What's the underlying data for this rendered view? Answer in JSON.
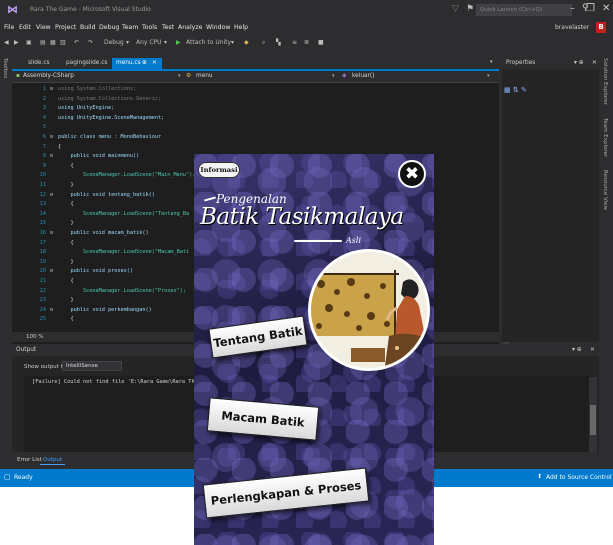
{
  "window": {
    "title": "Rara The Game - Microsoft Visual Studio"
  },
  "titlebar": {
    "quick_launch_placeholder": "Quick Launch (Ctrl+Q)"
  },
  "menu": [
    "File",
    "Edit",
    "View",
    "Project",
    "Build",
    "Debug",
    "Team",
    "Tools",
    "Test",
    "Analyze",
    "Window",
    "Help"
  ],
  "user": {
    "name": "bravelaster",
    "badge": "B"
  },
  "toolbar": {
    "config": "Debug",
    "platform": "Any CPU",
    "attach": "Attach to Unity"
  },
  "left_rail": "Toolbox",
  "tabs": [
    {
      "label": "slide.cs"
    },
    {
      "label": "pagingslide.cs"
    },
    {
      "label": "menu.cs",
      "active": true
    }
  ],
  "navbar": {
    "project": "Assembly-CSharp",
    "class": "menu",
    "member": "keluar()"
  },
  "code": {
    "lines": [
      {
        "n": "1",
        "fold": "⊟",
        "text": "using System.Collections;",
        "dim": true
      },
      {
        "n": "2",
        "fold": "",
        "text": "using System.Collections.Generic;",
        "dim": true
      },
      {
        "n": "3",
        "fold": "",
        "text": "using UnityEngine;"
      },
      {
        "n": "4",
        "fold": "",
        "text": "using UnityEngine.SceneManagement;"
      },
      {
        "n": "5",
        "fold": "",
        "text": ""
      },
      {
        "n": "6",
        "fold": "⊟",
        "text": "public class menu : MonoBehaviour"
      },
      {
        "n": "7",
        "fold": "",
        "text": "{"
      },
      {
        "n": "8",
        "fold": "⊟",
        "text": "    public void mainmenu()"
      },
      {
        "n": "9",
        "fold": "",
        "text": "    {"
      },
      {
        "n": "10",
        "fold": "",
        "text": "        SceneManager.LoadScene(\"Main_Menu\");"
      },
      {
        "n": "11",
        "fold": "",
        "text": "    }"
      },
      {
        "n": "12",
        "fold": "⊟",
        "text": "    public void tentang_batik()"
      },
      {
        "n": "13",
        "fold": "",
        "text": "    {"
      },
      {
        "n": "14",
        "fold": "",
        "text": "        SceneManager.LoadScene(\"Tentang_Ba"
      },
      {
        "n": "15",
        "fold": "",
        "text": "    }"
      },
      {
        "n": "16",
        "fold": "⊟",
        "text": "    public void macam_batik()"
      },
      {
        "n": "17",
        "fold": "",
        "text": "    {"
      },
      {
        "n": "18",
        "fold": "",
        "text": "        SceneManager.LoadScene(\"Macam_Bati"
      },
      {
        "n": "19",
        "fold": "",
        "text": "    }"
      },
      {
        "n": "20",
        "fold": "⊟",
        "text": "    public void proses()"
      },
      {
        "n": "21",
        "fold": "",
        "text": "    {"
      },
      {
        "n": "22",
        "fold": "",
        "text": "        SceneManager.LoadScene(\"Proses\");"
      },
      {
        "n": "23",
        "fold": "",
        "text": "    }"
      },
      {
        "n": "24",
        "fold": "⊟",
        "text": "    public void perkembangan()"
      },
      {
        "n": "25",
        "fold": "",
        "text": "    {"
      }
    ]
  },
  "zoom": "100 %",
  "properties": {
    "title": "Properties"
  },
  "right_rail": [
    "Solution Explorer",
    "Team Explorer",
    "Resource View"
  ],
  "output": {
    "title": "Output",
    "from_label": "Show output from:",
    "from_value": "IntelliSense",
    "text": "[Failure] Could not find file 'E:\\Rara Game\\Rara The G"
  },
  "bottom_tabs": [
    {
      "label": "Error List"
    },
    {
      "label": "Output",
      "active": true
    }
  ],
  "status": {
    "ready": "Ready",
    "source_control": "Add to Source Control"
  },
  "game": {
    "info_label": "Informasi",
    "close_glyph": "✖",
    "subtitle": "Pengenalan",
    "title": "Batik Tasikmalaya",
    "title_suffix": "Asli",
    "buttons": [
      "Tentang Batik",
      "Macam Batik",
      "Perlengkapan & Proses"
    ]
  },
  "colors": {
    "accent": "#007acc",
    "editor_bg": "#1e1e1e",
    "chrome_bg": "#2d2d30",
    "badge": "#c81e1e"
  }
}
